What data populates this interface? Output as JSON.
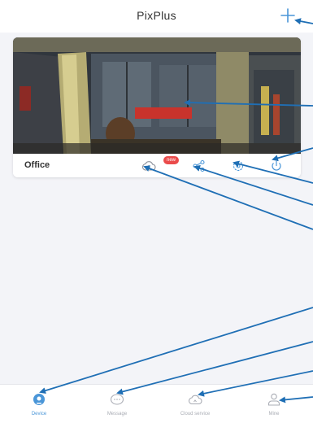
{
  "header": {
    "title": "PixPlus",
    "add_icon": "plus-icon"
  },
  "device_card": {
    "name": "Office",
    "badge": "new",
    "icons": [
      "cloud-replay-icon",
      "share-icon",
      "settings-icon",
      "power-icon"
    ]
  },
  "tabbar": {
    "tabs": [
      {
        "label": "Device",
        "icon": "device-icon",
        "active": true
      },
      {
        "label": "Message",
        "icon": "message-icon",
        "active": false
      },
      {
        "label": "Cloud service",
        "icon": "cloud-icon",
        "active": false
      },
      {
        "label": "Mine",
        "icon": "person-icon",
        "active": false
      }
    ]
  },
  "colors": {
    "accent": "#4a96d8",
    "badge": "#ea4b4b",
    "annotation": "#1f6fb5"
  }
}
